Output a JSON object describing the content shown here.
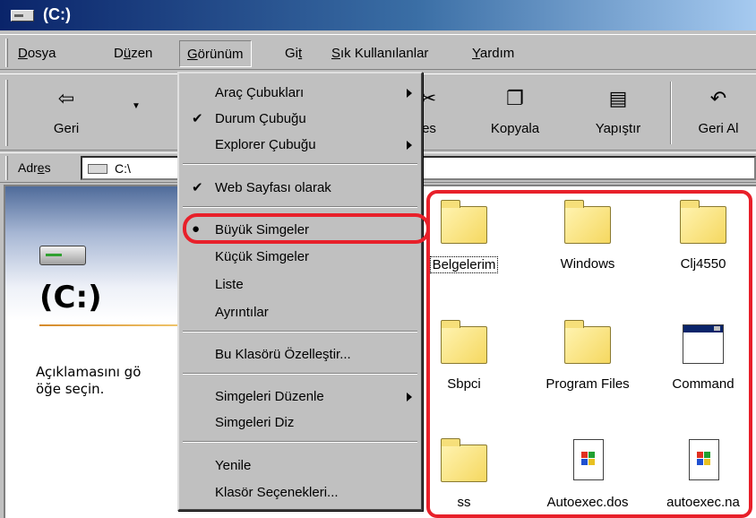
{
  "window": {
    "title": "(C:)"
  },
  "menubar": {
    "items": [
      {
        "pre": "",
        "u": "D",
        "post": "osya"
      },
      {
        "pre": "D",
        "u": "ü",
        "post": "zen"
      },
      {
        "pre": "",
        "u": "G",
        "post": "örünüm"
      },
      {
        "pre": "Gi",
        "u": "t",
        "post": ""
      },
      {
        "pre": "",
        "u": "S",
        "post": "ık Kullanılanlar"
      },
      {
        "pre": "",
        "u": "Y",
        "post": "ardım"
      }
    ]
  },
  "toolbar": {
    "back": {
      "label": "Geri",
      "icon": "back-arrow-icon"
    },
    "cut_partial": {
      "label": "es",
      "icon": "scissors-icon"
    },
    "copy": {
      "label": "Kopyala",
      "icon": "copy-icon"
    },
    "paste": {
      "label": "Yapıştır",
      "icon": "paste-icon"
    },
    "undo": {
      "label": "Geri Al",
      "icon": "undo-icon"
    }
  },
  "address": {
    "label_pre": "Adr",
    "label_u": "e",
    "label_post": "s",
    "value": "C:\\"
  },
  "left_pane": {
    "title": "(C:)",
    "desc_line1": "Açıklamasını gö",
    "desc_line2": "öğe seçin."
  },
  "view_menu": {
    "items": [
      {
        "text": "Araç Çubukları",
        "mark": "",
        "submenu": true
      },
      {
        "text": "Durum Çubuğu",
        "mark": "✔",
        "submenu": false
      },
      {
        "text": "Explorer Çubuğu",
        "mark": "",
        "submenu": true
      },
      {
        "text": "Web Sayfası olarak",
        "mark": "✔",
        "submenu": false
      },
      {
        "text": "Büyük Simgeler",
        "mark": "●",
        "submenu": false
      },
      {
        "text": "Küçük Simgeler",
        "mark": "",
        "submenu": false
      },
      {
        "text": "Liste",
        "mark": "",
        "submenu": false
      },
      {
        "text": "Ayrıntılar",
        "mark": "",
        "submenu": false
      },
      {
        "text": "Bu Klasörü Özelleştir...",
        "mark": "",
        "submenu": false
      },
      {
        "text": "Simgeleri Düzenle",
        "mark": "",
        "submenu": true
      },
      {
        "text": "Simgeleri Diz",
        "mark": "",
        "submenu": false
      },
      {
        "text": "Yenile",
        "mark": "",
        "submenu": false
      },
      {
        "text": "Klasör Seçenekleri...",
        "mark": "",
        "submenu": false
      }
    ]
  },
  "files": [
    {
      "name": "Belgelerim",
      "type": "documents-folder"
    },
    {
      "name": "Windows",
      "type": "folder"
    },
    {
      "name": "Clj4550",
      "type": "folder"
    },
    {
      "name": "Sbpci",
      "type": "folder"
    },
    {
      "name": "Program Files",
      "type": "folder"
    },
    {
      "name": "Command",
      "type": "program"
    },
    {
      "name": "ss",
      "type": "folder"
    },
    {
      "name": "Autoexec.dos",
      "type": "system-file"
    },
    {
      "name": "autoexec.na",
      "type": "system-file"
    }
  ],
  "colors": {
    "highlight": "#e8202a",
    "titlebar": "#0a246a",
    "face": "#c0c0c0"
  }
}
